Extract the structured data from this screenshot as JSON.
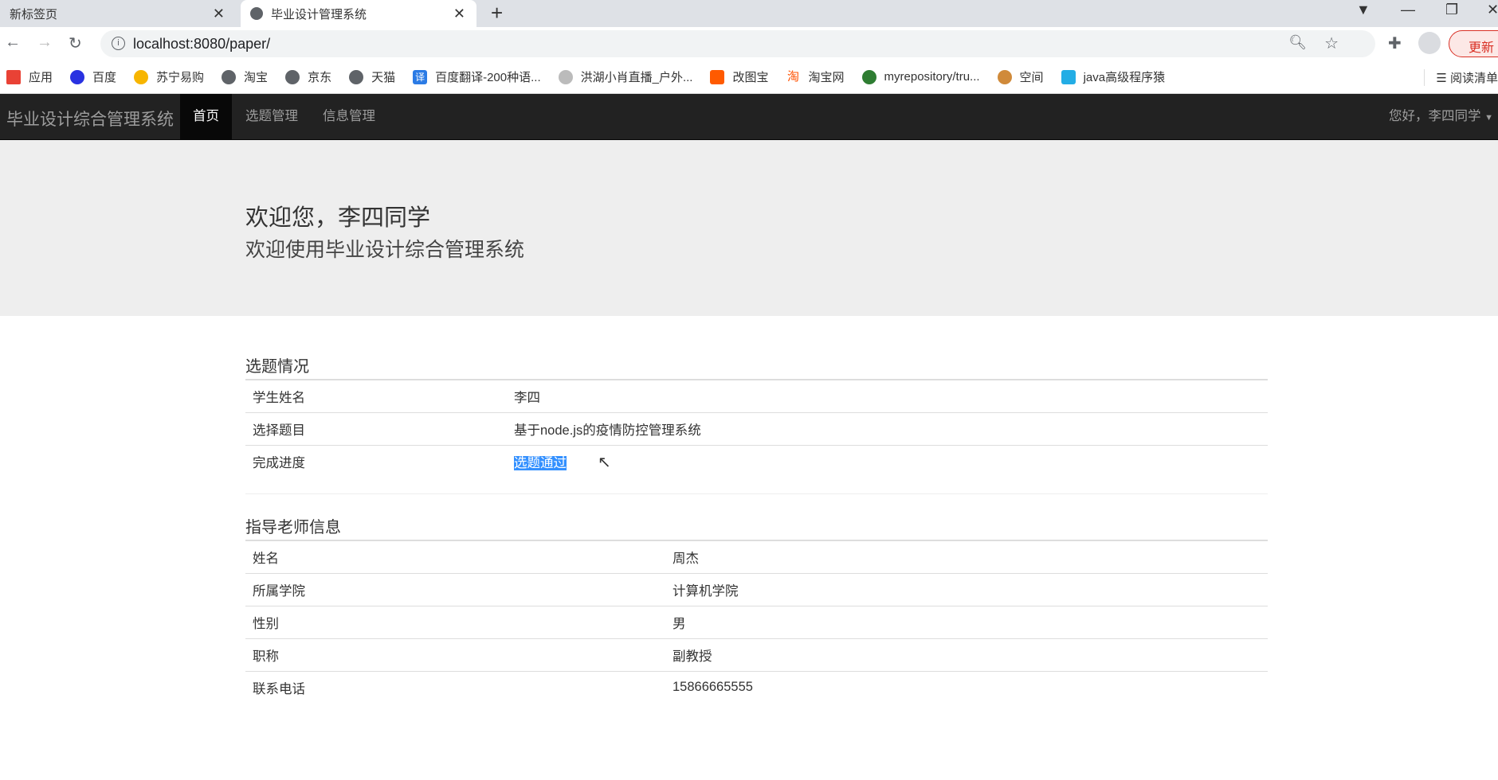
{
  "browser": {
    "tabs": [
      {
        "title": "新标签页"
      },
      {
        "title": "毕业设计管理系统"
      }
    ],
    "url": "localhost:8080/paper/",
    "update_label": "更新",
    "bookmarks": [
      {
        "label": "应用",
        "color": "#e94235"
      },
      {
        "label": "百度",
        "color": "#2932e1"
      },
      {
        "label": "苏宁易购",
        "color": "#f7b500"
      },
      {
        "label": "淘宝",
        "color": "#5f6368"
      },
      {
        "label": "京东",
        "color": "#5f6368"
      },
      {
        "label": "天猫",
        "color": "#5f6368"
      },
      {
        "label": "百度翻译-200种语...",
        "color": "#2b7be5"
      },
      {
        "label": "洪湖小肖直播_户外...",
        "color": "#999999"
      },
      {
        "label": "改图宝",
        "color": "#ff5a00"
      },
      {
        "label": "淘宝网",
        "color": "#ff5000"
      },
      {
        "label": "myrepository/tru...",
        "color": "#2e7d32"
      },
      {
        "label": "空间",
        "color": "#d08a3a"
      },
      {
        "label": "java高级程序猿",
        "color": "#23ade5"
      }
    ],
    "reading_list": "阅读清单"
  },
  "navbar": {
    "brand": "毕业设计综合管理系统",
    "items": [
      {
        "label": "首页"
      },
      {
        "label": "选题管理"
      },
      {
        "label": "信息管理"
      }
    ],
    "user": "您好，李四同学"
  },
  "jumbotron": {
    "title": "欢迎您，李四同学",
    "subtitle": "欢迎使用毕业设计综合管理系统"
  },
  "topic": {
    "heading": "选题情况",
    "rows": [
      {
        "label": "学生姓名",
        "value": "李四"
      },
      {
        "label": "选择题目",
        "value": "基于node.js的疫情防控管理系统"
      },
      {
        "label": "完成进度",
        "value": "选题通过"
      }
    ]
  },
  "teacher": {
    "heading": "指导老师信息",
    "rows": [
      {
        "label": "姓名",
        "value": "周杰"
      },
      {
        "label": "所属学院",
        "value": "计算机学院"
      },
      {
        "label": "性别",
        "value": "男"
      },
      {
        "label": "职称",
        "value": "副教授"
      },
      {
        "label": "联系电话",
        "value": "15866665555"
      }
    ]
  }
}
